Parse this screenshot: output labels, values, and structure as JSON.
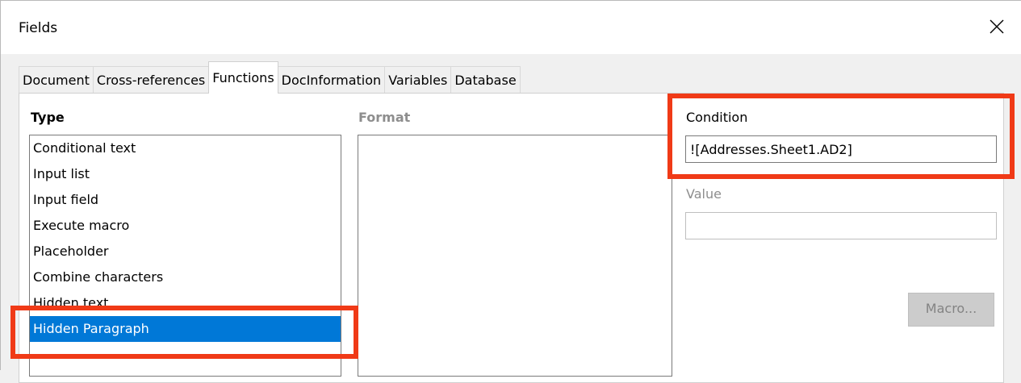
{
  "window": {
    "title": "Fields"
  },
  "tabs": [
    {
      "label": "Document",
      "active": false
    },
    {
      "label": "Cross-references",
      "active": false
    },
    {
      "label": "Functions",
      "active": true
    },
    {
      "label": "DocInformation",
      "active": false
    },
    {
      "label": "Variables",
      "active": false
    },
    {
      "label": "Database",
      "active": false
    }
  ],
  "type_panel": {
    "label": "Type",
    "items": [
      "Conditional text",
      "Input list",
      "Input field",
      "Execute macro",
      "Placeholder",
      "Combine characters",
      "Hidden text",
      "Hidden Paragraph"
    ],
    "selected": "Hidden Paragraph"
  },
  "format_panel": {
    "label": "Format"
  },
  "condition": {
    "label": "Condition",
    "value": "![Addresses.Sheet1.AD2]"
  },
  "value_field": {
    "label": "Value",
    "value": ""
  },
  "macro_button": {
    "label": "Macro..."
  },
  "colors": {
    "selection": "#0078d7",
    "highlight": "#f03a17"
  }
}
